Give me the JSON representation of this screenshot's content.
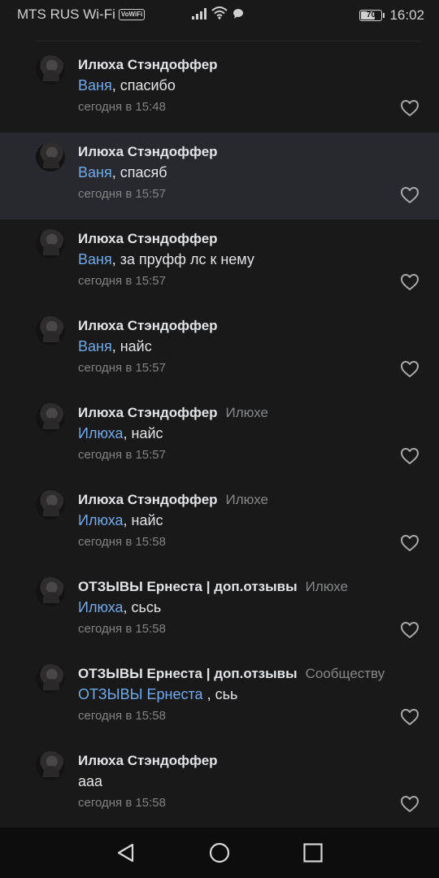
{
  "status": {
    "carrier": "MTS RUS Wi-Fi",
    "vowifi": "VoWiFi",
    "battery": "70",
    "battery_level": 0.7,
    "time": "16:02"
  },
  "icons": {
    "signal": "signal-icon",
    "wifi": "wifi-icon",
    "message": "message-icon",
    "heart": "heart-outline-icon",
    "back": "triangle-back-icon",
    "home": "circle-home-icon",
    "recents": "square-recents-icon"
  },
  "colors": {
    "mention": "#71aaeb",
    "highlight": "#27292e",
    "background": "#19191a"
  },
  "comments": [
    {
      "author": "Илюха Стэндоффер",
      "reply_to": "",
      "mention": "Ваня",
      "text": ", спасибо",
      "time": "сегодня в 15:48",
      "highlighted": false
    },
    {
      "author": "Илюха Стэндоффер",
      "reply_to": "",
      "mention": "Ваня",
      "text": ", спасяб",
      "time": "сегодня в 15:57",
      "highlighted": true
    },
    {
      "author": "Илюха Стэндоффер",
      "reply_to": "",
      "mention": "Ваня",
      "text": ", за пруфф лс к нему",
      "time": "сегодня в 15:57",
      "highlighted": false
    },
    {
      "author": "Илюха Стэндоффер",
      "reply_to": "",
      "mention": "Ваня",
      "text": ", найс",
      "time": "сегодня в 15:57",
      "highlighted": false
    },
    {
      "author": "Илюха Стэндоффер",
      "reply_to": "Илюхе",
      "mention": "Илюха",
      "text": ", найс",
      "time": "сегодня в 15:57",
      "highlighted": false
    },
    {
      "author": "Илюха Стэндоффер",
      "reply_to": "Илюхе",
      "mention": "Илюха",
      "text": ", найс",
      "time": "сегодня в 15:58",
      "highlighted": false
    },
    {
      "author": "ОТЗЫВЫ Ернеста | доп.отзывы",
      "reply_to": "Илюхе",
      "mention": "Илюха",
      "text": ", сьсь",
      "time": "сегодня в 15:58",
      "highlighted": false
    },
    {
      "author": "ОТЗЫВЫ Ернеста | доп.отзывы",
      "reply_to": "Сообществу",
      "mention": "ОТЗЫВЫ Ернеста ",
      "text": ", сьь",
      "time": "сегодня в 15:58",
      "highlighted": false
    },
    {
      "author": "Илюха Стэндоффер",
      "reply_to": "",
      "mention": "",
      "text": "ааа",
      "time": "сегодня в 15:58",
      "highlighted": false
    }
  ]
}
